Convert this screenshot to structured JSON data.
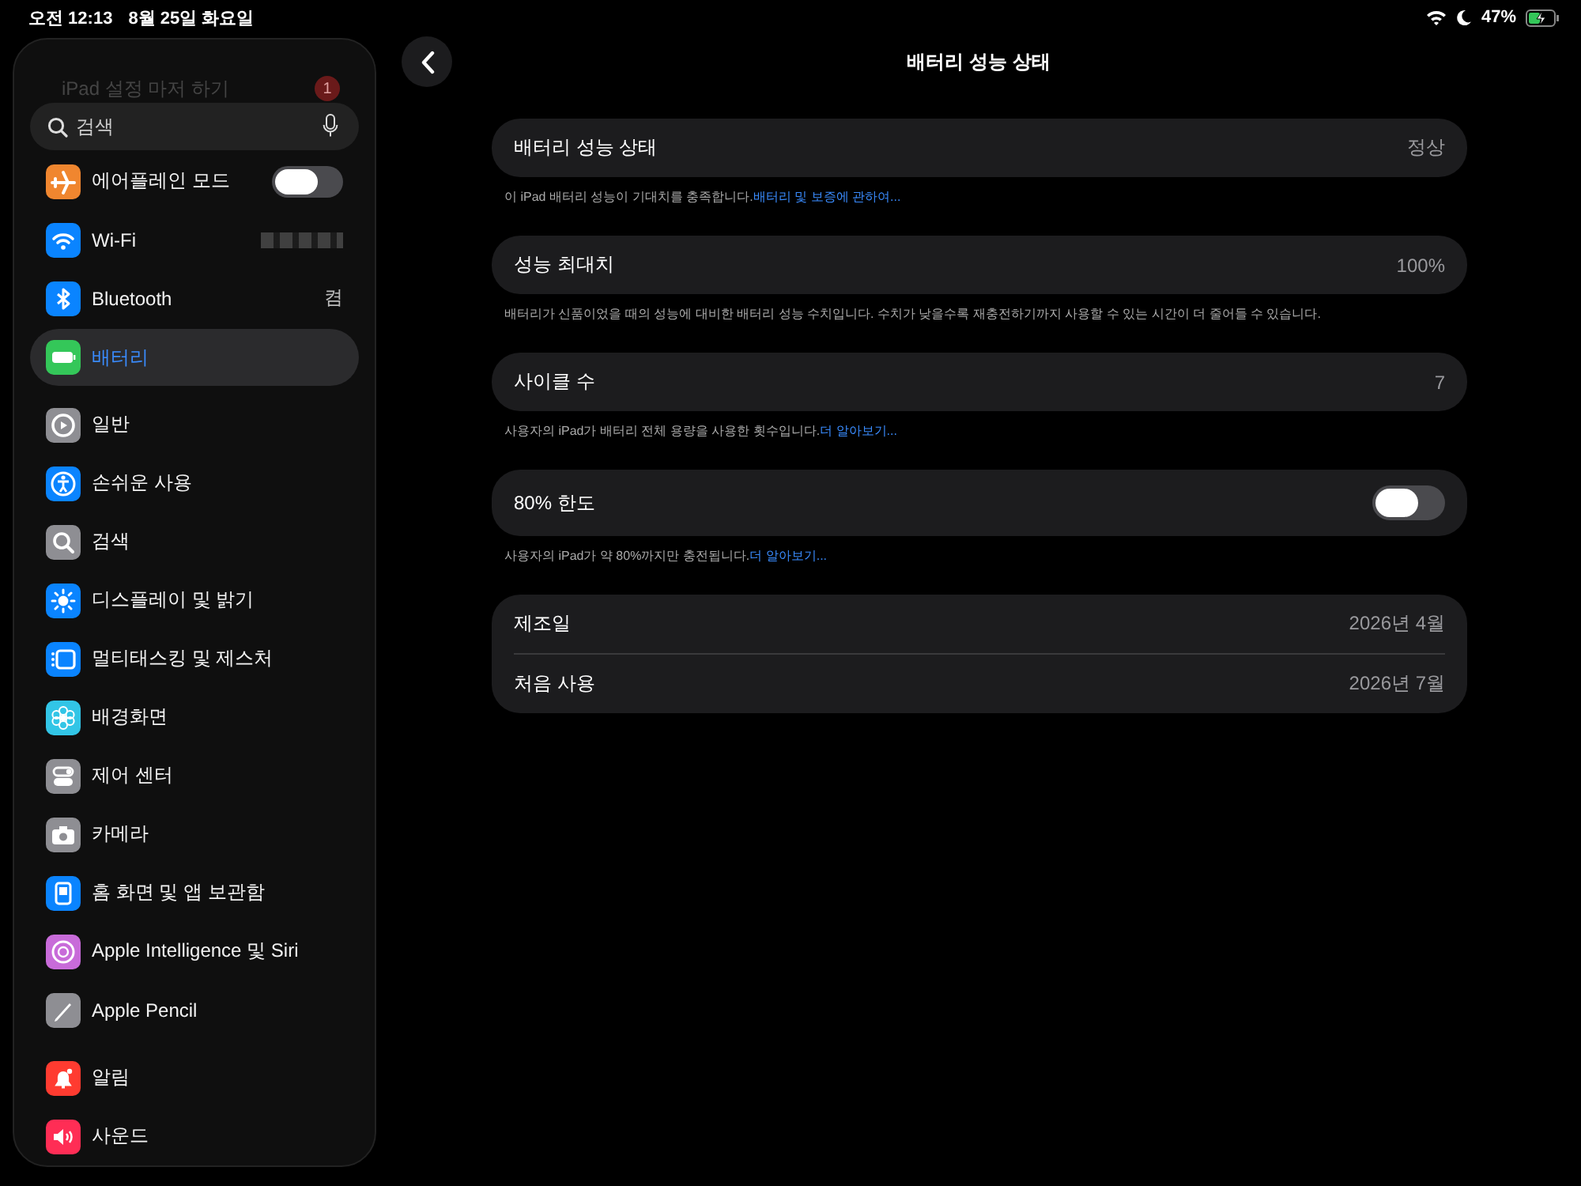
{
  "status_bar": {
    "time": "오전 12:13",
    "date": "8월 25일 화요일",
    "battery": "47%",
    "charging": true
  },
  "sidebar": {
    "setup_banner": {
      "label": "iPad 설정 마저 하기",
      "badge": "1"
    },
    "search": {
      "placeholder": "검색"
    },
    "groups": [
      [
        {
          "label": "에어플레인 모드",
          "kind": "toggle",
          "on": false,
          "selected": false,
          "color": "#f0862f"
        },
        {
          "label": "Wi-Fi",
          "kind": "redacted",
          "selected": false,
          "color": "#0a84ff"
        },
        {
          "label": "Bluetooth",
          "kind": "value",
          "value": "켬",
          "selected": false,
          "color": "#0a84ff"
        },
        {
          "label": "배터리",
          "kind": "plain",
          "selected": true,
          "color": "#34c759"
        }
      ],
      [
        {
          "label": "일반",
          "kind": "plain",
          "selected": false,
          "color": "#8e8e93"
        },
        {
          "label": "손쉬운 사용",
          "kind": "plain",
          "selected": false,
          "color": "#0a84ff"
        },
        {
          "label": "검색",
          "kind": "plain",
          "selected": false,
          "color": "#8e8e93"
        },
        {
          "label": "디스플레이 및 밝기",
          "kind": "plain",
          "selected": false,
          "color": "#0a84ff"
        },
        {
          "label": "멀티태스킹 및 제스처",
          "kind": "plain",
          "selected": false,
          "color": "#0a84ff"
        },
        {
          "label": "배경화면",
          "kind": "plain",
          "selected": false,
          "color": "#32c5e6"
        },
        {
          "label": "제어 센터",
          "kind": "plain",
          "selected": false,
          "color": "#8e8e93"
        },
        {
          "label": "카메라",
          "kind": "plain",
          "selected": false,
          "color": "#8e8e93"
        },
        {
          "label": "홈 화면 및 앱 보관함",
          "kind": "plain",
          "selected": false,
          "color": "#0a84ff"
        },
        {
          "label": "Apple Intelligence 및 Siri",
          "kind": "plain",
          "selected": false,
          "color": "#c86bd9"
        },
        {
          "label": "Apple Pencil",
          "kind": "plain",
          "selected": false,
          "color": "#8e8e93"
        }
      ],
      [
        {
          "label": "알림",
          "kind": "plain",
          "selected": false,
          "color": "#ff3b30"
        },
        {
          "label": "사운드",
          "kind": "plain",
          "selected": false,
          "color": "#ff2d55"
        }
      ]
    ]
  },
  "main": {
    "title": "배터리 성능 상태",
    "sections": [
      {
        "rows": [
          {
            "label": "배터리 성능 상태",
            "kind": "value",
            "value": "정상"
          }
        ],
        "footnote": {
          "text": "이 iPad 배터리 성능이 기대치를 충족합니다.",
          "link": "배터리 및 보증에 관하여..."
        }
      },
      {
        "rows": [
          {
            "label": "성능 최대치",
            "kind": "value",
            "value": "100%"
          }
        ],
        "footnote": {
          "text": "배터리가 신품이었을 때의 성능에 대비한 배터리 성능 수치입니다. 수치가 낮을수록 재충전하기까지 사용할 수 있는 시간이 더 줄어들 수 있습니다."
        }
      },
      {
        "rows": [
          {
            "label": "사이클 수",
            "kind": "value",
            "value": "7"
          }
        ],
        "footnote": {
          "text": "사용자의 iPad가 배터리 전체 용량을 사용한 횟수입니다.",
          "link": "더 알아보기..."
        }
      },
      {
        "rows": [
          {
            "label": "80% 한도",
            "kind": "toggle",
            "on": false
          }
        ],
        "footnote": {
          "text": "사용자의 iPad가 약 80%까지만 충전됩니다.",
          "link": "더 알아보기..."
        }
      },
      {
        "rows": [
          {
            "label": "제조일",
            "kind": "value",
            "value": "2026년 4월"
          },
          {
            "label": "처음 사용",
            "kind": "value",
            "value": "2026년 7월"
          }
        ]
      }
    ]
  }
}
